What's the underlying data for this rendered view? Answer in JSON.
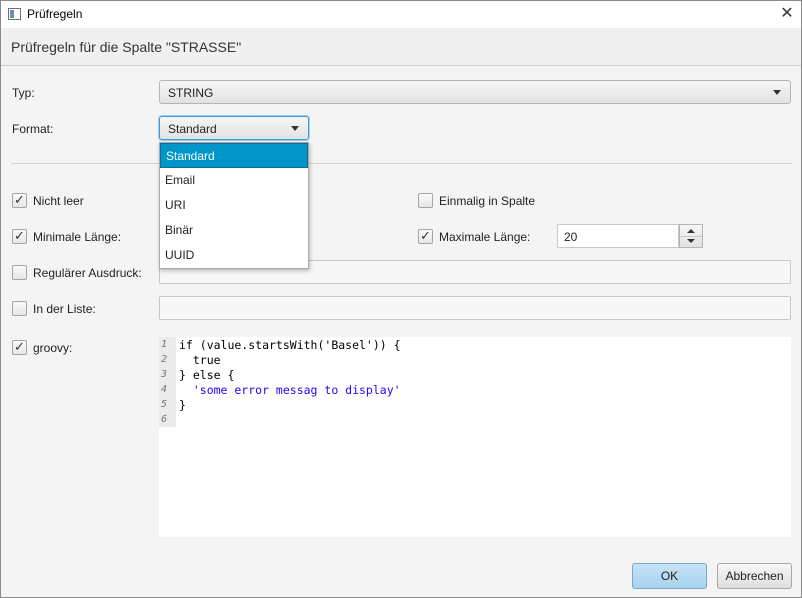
{
  "window": {
    "title": "Prüfregeln",
    "close": "✕"
  },
  "header": {
    "text": "Prüfregeln für die Spalte \"STRASSE\""
  },
  "form": {
    "typ_label": "Typ:",
    "typ_value": "STRING",
    "format_label": "Format:",
    "format_value": "Standard",
    "format_options": [
      "Standard",
      "Email",
      "URI",
      "Binär",
      "UUID"
    ],
    "nicht_leer_label": "Nicht leer",
    "einmalig_label": "Einmalig in Spalte",
    "minimale_label": "Minimale Länge:",
    "maximale_label": "Maximale Länge:",
    "maximale_value": "20",
    "regex_label": "Regulärer Ausdruck:",
    "liste_label": "In der Liste:",
    "groovy_label": "groovy:"
  },
  "editor": {
    "line_numbers": [
      "1",
      "2",
      "3",
      "4",
      "5",
      "6"
    ],
    "lines": [
      "if (value.startsWith('Basel')) {",
      "  true",
      "} else {",
      "  'some error messag to display'",
      "}",
      ""
    ]
  },
  "buttons": {
    "ok": "OK",
    "cancel": "Abbrechen"
  }
}
